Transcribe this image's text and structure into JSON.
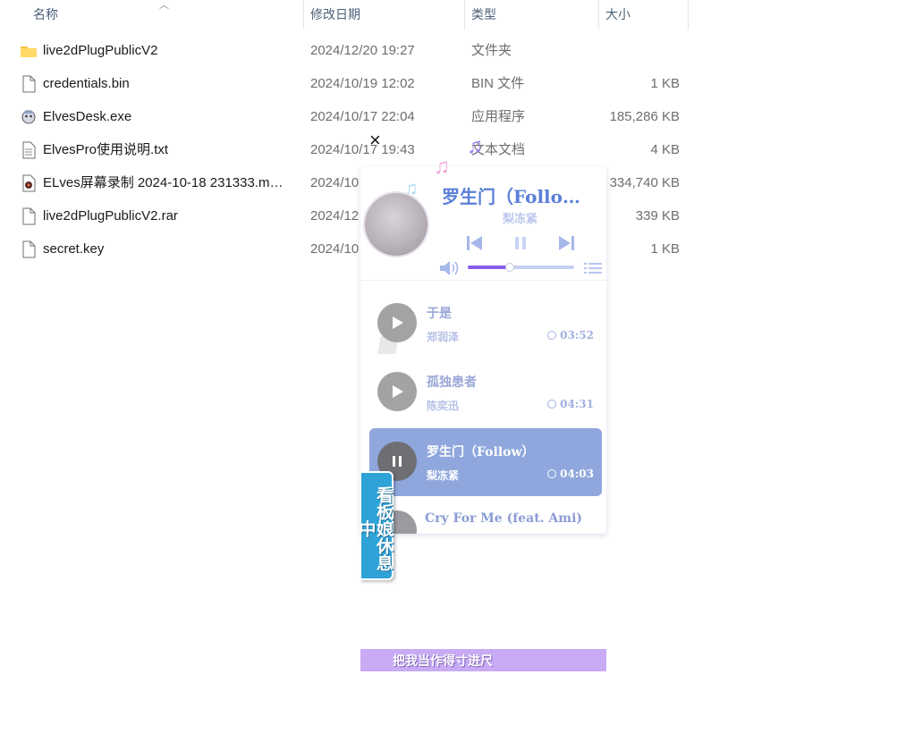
{
  "explorer": {
    "columns": {
      "name": "名称",
      "date": "修改日期",
      "type": "类型",
      "size": "大小"
    },
    "files": [
      {
        "name": "live2dPlugPublicV2",
        "date": "2024/12/20 19:27",
        "type": "文件夹",
        "size": "",
        "icon": "folder-icon"
      },
      {
        "name": "credentials.bin",
        "date": "2024/10/19 12:02",
        "type": "BIN 文件",
        "size": "1 KB",
        "icon": "file-icon"
      },
      {
        "name": "ElvesDesk.exe",
        "date": "2024/10/17 22:04",
        "type": "应用程序",
        "size": "185,286 KB",
        "icon": "app-icon"
      },
      {
        "name": "ElvesPro使用说明.txt",
        "date": "2024/10/17 19:43",
        "type": "文本文档",
        "size": "4 KB",
        "icon": "text-file-icon"
      },
      {
        "name": "ELves屏幕录制 2024-10-18 231333.m…",
        "date": "2024/10",
        "type": "",
        "size": "334,740 KB",
        "icon": "video-file-icon"
      },
      {
        "name": "live2dPlugPublicV2.rar",
        "date": "2024/12",
        "type": "",
        "size": "339 KB",
        "icon": "file-icon"
      },
      {
        "name": "secret.key",
        "date": "2024/10",
        "type": "",
        "size": "1 KB",
        "icon": "file-icon"
      }
    ]
  },
  "player": {
    "close_label": "×",
    "now_playing": {
      "title": "罗生门（Follo…",
      "artist": "梨冻紧"
    },
    "progress": 0.39,
    "tracks": [
      {
        "name": "于是",
        "artist": "郑润泽",
        "duration": "03:52",
        "active": false
      },
      {
        "name": "孤独患者",
        "artist": "陈奕迅",
        "duration": "04:31",
        "active": false
      },
      {
        "name": "罗生门（Follow）",
        "artist": "梨冻紧",
        "duration": "04:03",
        "active": true
      }
    ],
    "partial_track": "Cry For Me (feat. Ami)"
  },
  "mascot": {
    "resting_label": "看板娘休息中",
    "speech": "把我当作得寸进尺"
  },
  "colors": {
    "accent": "#8a5cf0",
    "title": "#5a7fd8",
    "active_track": "#8fa7dd",
    "badge": "#2fa3d8",
    "speech_bar": "#c8aaf5"
  }
}
